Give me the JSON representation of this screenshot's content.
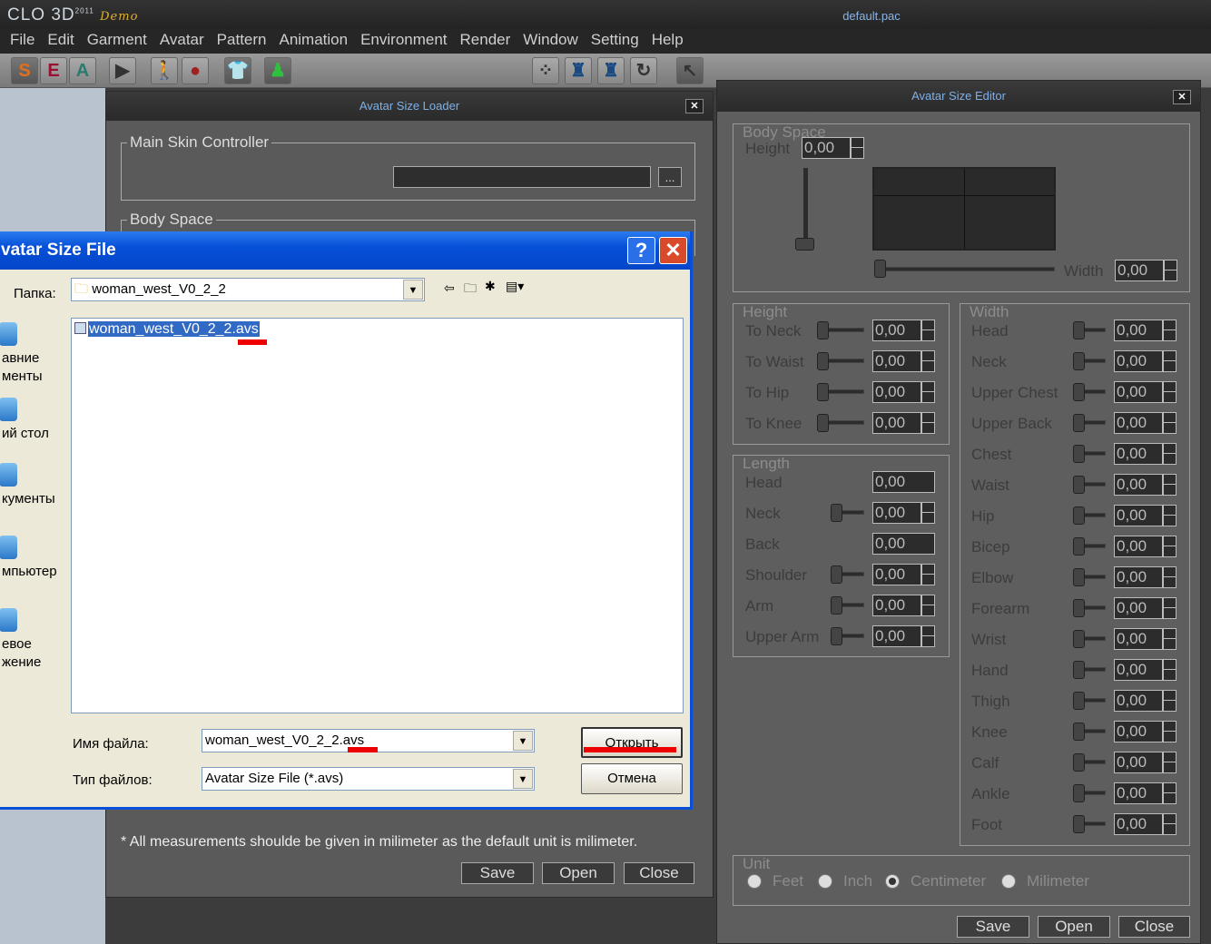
{
  "app": {
    "logo": "CLO 3D",
    "logo_year": "2011",
    "logo_edition": "Demo",
    "document": "default.pac"
  },
  "menu": [
    "File",
    "Edit",
    "Garment",
    "Avatar",
    "Pattern",
    "Animation",
    "Environment",
    "Render",
    "Window",
    "Setting",
    "Help"
  ],
  "toolbar": {
    "s": "S",
    "e": "E",
    "a": "A"
  },
  "loader": {
    "title": "Avatar Size Loader",
    "main_skin_label": "Main Skin Controller",
    "browse": "...",
    "body_space_label": "Body Space",
    "note": "* All measurements shoulde be given in milimeter as the default unit is milimeter.",
    "save": "Save",
    "open": "Open",
    "close": "Close"
  },
  "dialog": {
    "title": "vatar Size File",
    "help": "?",
    "folder_label": "Папка:",
    "folder": "woman_west_V0_2_2",
    "places": [
      "авние\nменты",
      "ий стол",
      "кументы",
      "мпьютер",
      "евое\nжение"
    ],
    "files": [
      "woman_west_V0_2_2.avs"
    ],
    "filename_label": "Имя файла:",
    "filename": "woman_west_V0_2_2.avs",
    "filetype_label": "Тип файлов:",
    "filetype": "Avatar Size File (*.avs)",
    "open": "Открыть",
    "cancel": "Отмена"
  },
  "editor": {
    "title": "Avatar Size Editor",
    "body_space": {
      "label": "Body Space",
      "height_label": "Height",
      "height": "0,00",
      "width_label": "Width",
      "width": "0,00"
    },
    "height_group": {
      "label": "Height",
      "rows": [
        {
          "label": "To Neck",
          "value": "0,00",
          "slider": true
        },
        {
          "label": "To Waist",
          "value": "0,00",
          "slider": true
        },
        {
          "label": "To Hip",
          "value": "0,00",
          "slider": true
        },
        {
          "label": "To Knee",
          "value": "0,00",
          "slider": true
        }
      ]
    },
    "length_group": {
      "label": "Length",
      "rows": [
        {
          "label": "Head",
          "value": "0,00",
          "slider": false
        },
        {
          "label": "Neck",
          "value": "0,00",
          "slider": true
        },
        {
          "label": "Back",
          "value": "0,00",
          "slider": false
        },
        {
          "label": "Shoulder",
          "value": "0,00",
          "slider": true
        },
        {
          "label": "Arm",
          "value": "0,00",
          "slider": true
        },
        {
          "label": "Upper Arm",
          "value": "0,00",
          "slider": true
        }
      ]
    },
    "width_group": {
      "label": "Width",
      "rows": [
        {
          "label": "Head",
          "value": "0,00"
        },
        {
          "label": "Neck",
          "value": "0,00"
        },
        {
          "label": "Upper Chest",
          "value": "0,00"
        },
        {
          "label": "Upper Back",
          "value": "0,00"
        },
        {
          "label": "Chest",
          "value": "0,00"
        },
        {
          "label": "Waist",
          "value": "0,00"
        },
        {
          "label": "Hip",
          "value": "0,00"
        },
        {
          "label": "Bicep",
          "value": "0,00"
        },
        {
          "label": "Elbow",
          "value": "0,00"
        },
        {
          "label": "Forearm",
          "value": "0,00"
        },
        {
          "label": "Wrist",
          "value": "0,00"
        },
        {
          "label": "Hand",
          "value": "0,00"
        },
        {
          "label": "Thigh",
          "value": "0,00"
        },
        {
          "label": "Knee",
          "value": "0,00"
        },
        {
          "label": "Calf",
          "value": "0,00"
        },
        {
          "label": "Ankle",
          "value": "0,00"
        },
        {
          "label": "Foot",
          "value": "0,00"
        }
      ]
    },
    "unit": {
      "label": "Unit",
      "options": [
        "Feet",
        "Inch",
        "Centimeter",
        "Milimeter"
      ],
      "selected": "Centimeter"
    },
    "save": "Save",
    "open": "Open",
    "close": "Close"
  }
}
